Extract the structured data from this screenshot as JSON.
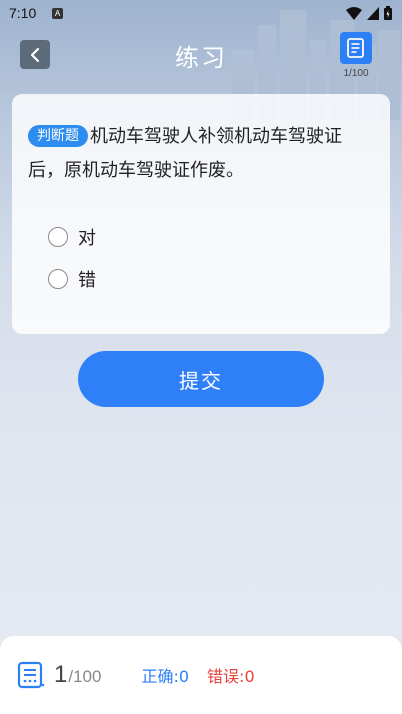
{
  "status_bar": {
    "time": "7:10",
    "notification_icon": "A"
  },
  "header": {
    "title": "练习",
    "back_icon": "chevron-left-icon",
    "sheet_icon": "answer-sheet-icon",
    "sheet_count": "1/100"
  },
  "question": {
    "type_label": "判断题",
    "text": "机动车驾驶人补领机动车驾驶证后，原机动车驾驶证作废。",
    "options": [
      {
        "label": "对"
      },
      {
        "label": "错"
      }
    ]
  },
  "submit": {
    "label": "提交"
  },
  "footer": {
    "current": "1",
    "total": "/100",
    "correct_label": "正确:",
    "correct_count": "0",
    "wrong_label": "错误:",
    "wrong_count": "0"
  },
  "colors": {
    "accent": "#2f7ff9",
    "correct": "#2d7ff5",
    "wrong": "#e8433b"
  }
}
